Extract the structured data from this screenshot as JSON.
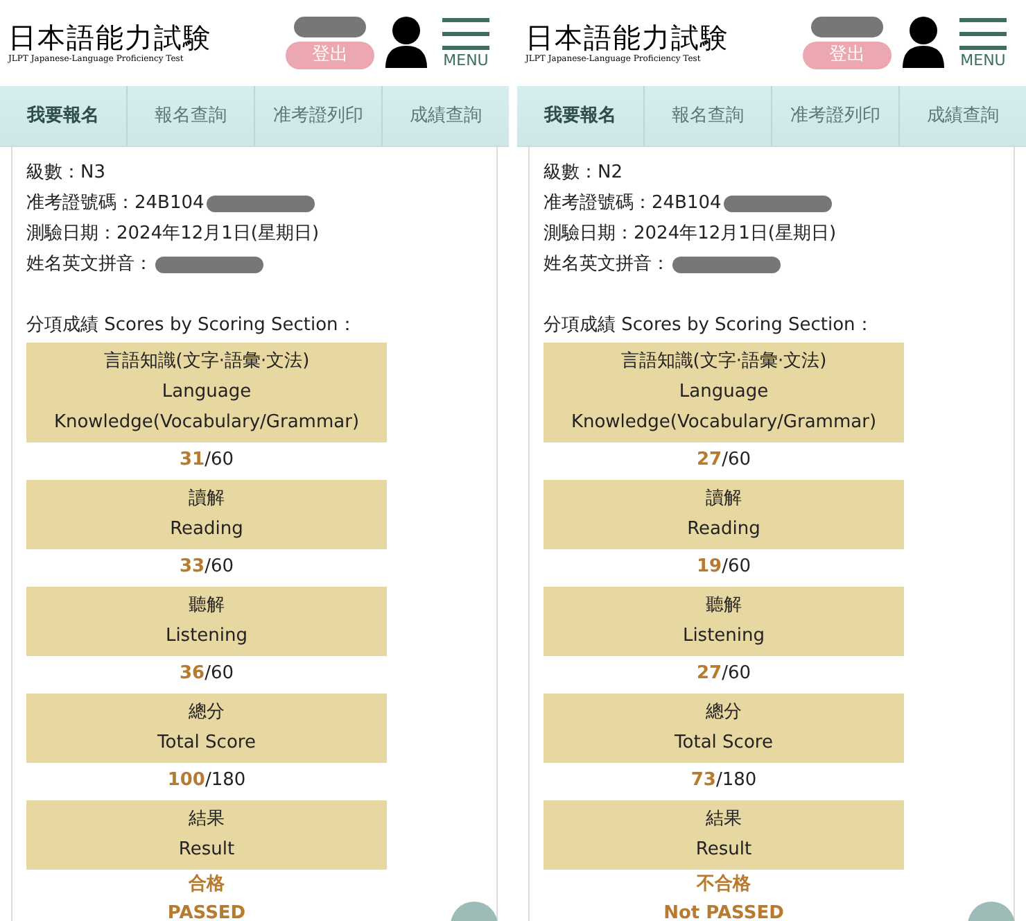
{
  "panels": [
    {
      "header": {
        "logo_title": "日本語能力試験",
        "logo_subtitle": "JLPT Japanese-Language Proficiency Test",
        "username_redacted": true,
        "logout_button": "登出",
        "menu_label": "MENU"
      },
      "tabs": [
        {
          "label": "我要報名",
          "selected": true
        },
        {
          "label": "報名查詢",
          "selected": false
        },
        {
          "label": "准考證列印",
          "selected": false
        },
        {
          "label": "成績查詢",
          "selected": false
        }
      ],
      "info": [
        {
          "text": "級數：N3",
          "redacted": false
        },
        {
          "text": "准考證號碼：24B104",
          "redacted": true
        },
        {
          "text": "測驗日期：2024年12月1日(星期日)",
          "redacted": false
        },
        {
          "text": "姓名英文拼音：",
          "redacted": true
        }
      ],
      "scores_heading": "分項成績 Scores by Scoring Section：",
      "sections": [
        {
          "label_zh": "言語知識(文字·語彙·文法)",
          "label_en": "Language Knowledge(Vocabulary/Grammar)",
          "score": "31",
          "max": "/60"
        },
        {
          "label_zh": "讀解",
          "label_en": "Reading",
          "score": "33",
          "max": "/60"
        },
        {
          "label_zh": "聽解",
          "label_en": "Listening",
          "score": "36",
          "max": "/60"
        },
        {
          "label_zh": "總分",
          "label_en": "Total Score",
          "score": "100",
          "max": "/180"
        },
        {
          "label_zh": "結果",
          "label_en": "Result",
          "result_lines": [
            "合格",
            "PASSED"
          ]
        }
      ]
    },
    {
      "header": {
        "logo_title": "日本語能力試験",
        "logo_subtitle": "JLPT Japanese-Language Proficiency Test",
        "username_redacted": true,
        "logout_button": "登出",
        "menu_label": "MENU"
      },
      "tabs": [
        {
          "label": "我要報名",
          "selected": true
        },
        {
          "label": "報名查詢",
          "selected": false
        },
        {
          "label": "准考證列印",
          "selected": false
        },
        {
          "label": "成績查詢",
          "selected": false
        }
      ],
      "info": [
        {
          "text": "級數：N2",
          "redacted": false
        },
        {
          "text": "准考證號碼：24B104",
          "redacted": true
        },
        {
          "text": "測驗日期：2024年12月1日(星期日)",
          "redacted": false
        },
        {
          "text": "姓名英文拼音：",
          "redacted": true
        }
      ],
      "scores_heading": "分項成績 Scores by Scoring Section：",
      "sections": [
        {
          "label_zh": "言語知識(文字·語彙·文法)",
          "label_en": "Language Knowledge(Vocabulary/Grammar)",
          "score": "27",
          "max": "/60"
        },
        {
          "label_zh": "讀解",
          "label_en": "Reading",
          "score": "19",
          "max": "/60"
        },
        {
          "label_zh": "聽解",
          "label_en": "Listening",
          "score": "27",
          "max": "/60"
        },
        {
          "label_zh": "總分",
          "label_en": "Total Score",
          "score": "73",
          "max": "/180"
        },
        {
          "label_zh": "結果",
          "label_en": "Result",
          "result_lines": [
            "不合格",
            "Not PASSED"
          ]
        }
      ]
    }
  ]
}
